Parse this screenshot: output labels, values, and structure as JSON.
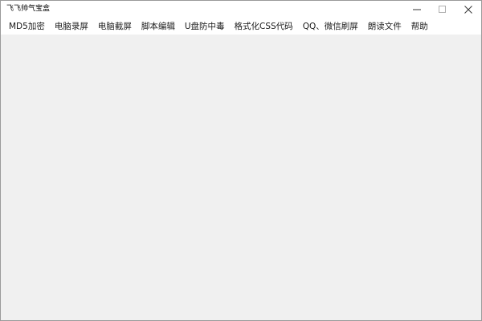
{
  "window": {
    "title": "飞飞帅气宝盒",
    "controls": {
      "minimize_icon": "minimize-icon",
      "maximize_icon": "maximize-icon",
      "close_icon": "close-icon"
    }
  },
  "menubar": {
    "items": [
      {
        "label": "MD5加密"
      },
      {
        "label": "电脑录屏"
      },
      {
        "label": "电脑截屏"
      },
      {
        "label": "脚本编辑"
      },
      {
        "label": "U盘防中毒"
      },
      {
        "label": "格式化CSS代码"
      },
      {
        "label": "QQ、微信刷屏"
      },
      {
        "label": "朗读文件"
      },
      {
        "label": "帮助"
      }
    ]
  },
  "colors": {
    "titlebar_bg": "#ffffff",
    "client_bg": "#f0f0f0",
    "border": "#9a9a9a"
  }
}
